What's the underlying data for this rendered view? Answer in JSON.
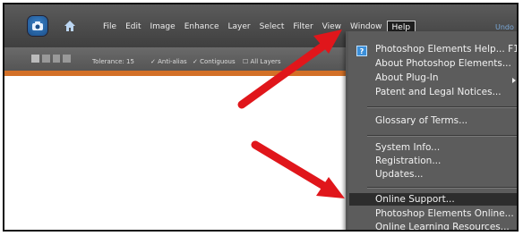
{
  "app": {
    "menu": [
      "File",
      "Edit",
      "Image",
      "Enhance",
      "Layer",
      "Select",
      "Filter",
      "View",
      "Window",
      "Help"
    ],
    "undo_label": "Undo"
  },
  "toolbar": {
    "tolerance_label": "Tolerance:",
    "tolerance_value": "15",
    "antialias_label": "Anti-alias",
    "contiguous_label": "Contiguous",
    "all_layers_label": "All Layers"
  },
  "help_menu": {
    "items": [
      {
        "label": "Photoshop Elements Help... F1"
      },
      {
        "label": "About Photoshop Elements..."
      },
      {
        "label": "About Plug-In"
      },
      {
        "label": "Patent and Legal Notices..."
      },
      {
        "label": "Glossary of Terms..."
      },
      {
        "label": "System Info..."
      },
      {
        "label": "Registration..."
      },
      {
        "label": "Updates..."
      },
      {
        "label": "Online Support..."
      },
      {
        "label": "Photoshop Elements Online..."
      },
      {
        "label": "Online Learning Resources..."
      }
    ],
    "highlighted": "Online Support..."
  },
  "colors": {
    "menubar": "#4a4a4a",
    "menu_bg": "#5c5c5c",
    "accent_orange": "#d37027",
    "arrow_red": "#e0161b"
  },
  "icons": [
    "camera-icon",
    "home-icon",
    "help-book-icon",
    "submenu-arrow-icon"
  ]
}
